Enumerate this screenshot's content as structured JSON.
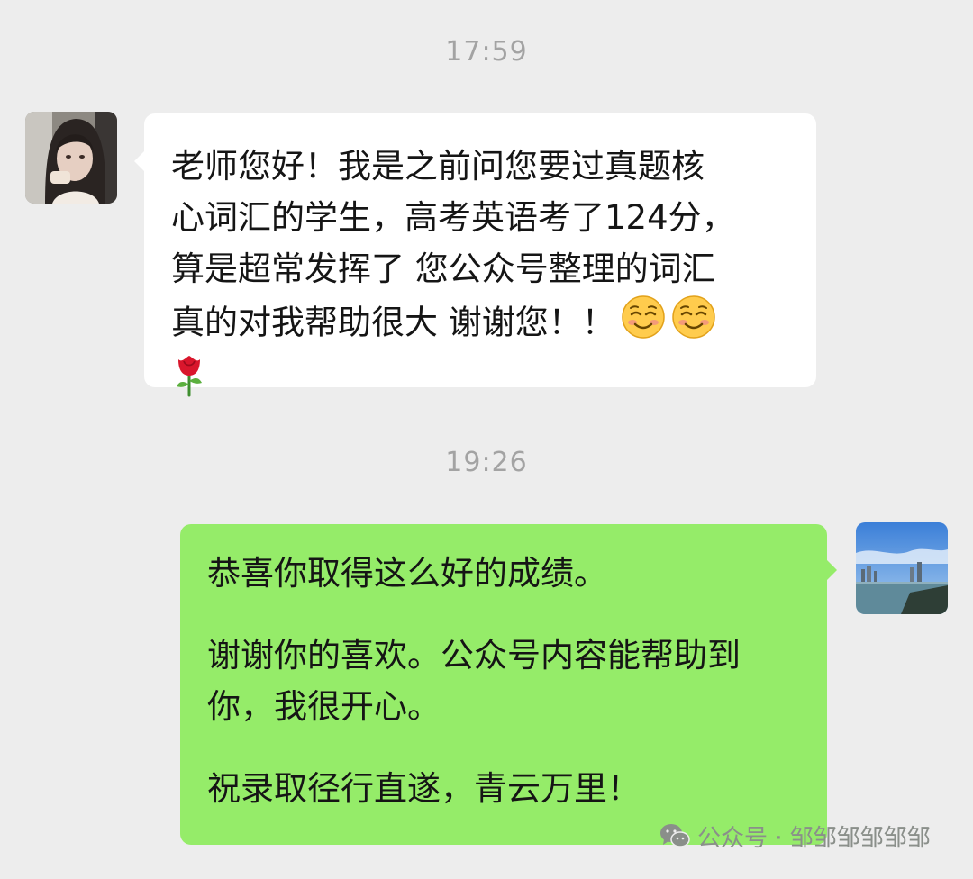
{
  "chat": {
    "time_1": "17:59",
    "time_2": "19:26",
    "incoming": {
      "lines": [
        "老师您好！我是之前问您要过真题核",
        "心词汇的学生，高考英语考了124分，",
        "算是超常发挥了 您公众号整理的词汇",
        "真的对我帮助很大 谢谢您！！"
      ],
      "emojis": [
        "blush-emoji",
        "blush-emoji",
        "rose-emoji"
      ]
    },
    "outgoing": {
      "paragraph_1": "恭喜你取得这么好的成绩。",
      "paragraph_2_lines": [
        "谢谢你的喜欢。公众号内容能帮助到",
        "你，我很开心。"
      ],
      "paragraph_3": "祝录取径行直遂，青云万里！"
    }
  },
  "watermark": {
    "icon": "wechat-icon",
    "text": "公众号 · 邹邹邹邹邹邹"
  },
  "colors": {
    "background": "#ededed",
    "incoming_bubble": "#ffffff",
    "outgoing_bubble": "#95ec69",
    "timestamp": "#a3a3a3"
  }
}
